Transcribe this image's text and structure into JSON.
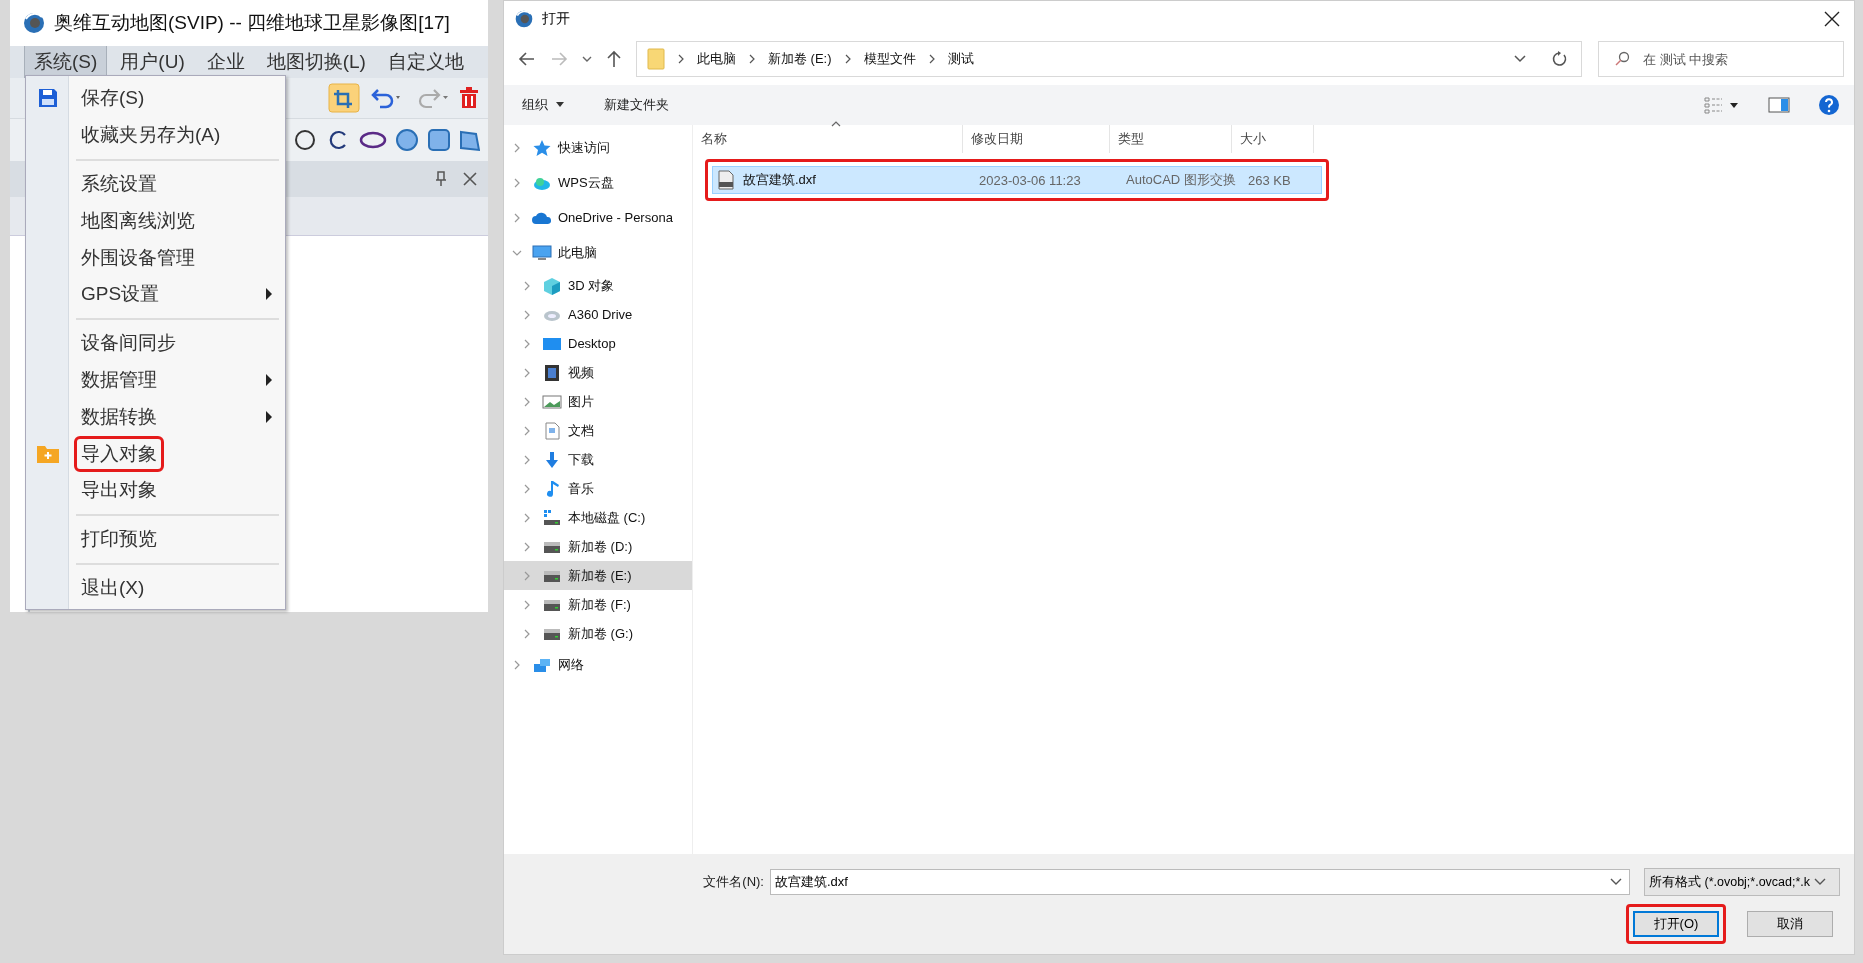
{
  "app": {
    "title": "奥维互动地图(SVIP) -- 四维地球卫星影像图[17]",
    "menu_bar": [
      {
        "label": "系统(S)",
        "selected": true
      },
      {
        "label": "用户(U)",
        "selected": false
      },
      {
        "label": "企业",
        "selected": false
      },
      {
        "label": "地图切换(L)",
        "selected": false
      },
      {
        "label": "自定义地",
        "selected": false
      }
    ],
    "menu": [
      {
        "kind": "save",
        "label": "保存(S)",
        "submenu": false,
        "highlighted": false
      },
      {
        "kind": "plain",
        "label": "收藏夹另存为(A)",
        "submenu": false,
        "highlighted": false
      },
      {
        "kind": "separator"
      },
      {
        "kind": "plain",
        "label": "系统设置",
        "submenu": false,
        "highlighted": false
      },
      {
        "kind": "plain",
        "label": "地图离线浏览",
        "submenu": false,
        "highlighted": false
      },
      {
        "kind": "plain",
        "label": "外围设备管理",
        "submenu": false,
        "highlighted": false
      },
      {
        "kind": "plain",
        "label": "GPS设置",
        "submenu": true,
        "highlighted": false
      },
      {
        "kind": "separator"
      },
      {
        "kind": "plain",
        "label": "设备间同步",
        "submenu": false,
        "highlighted": false
      },
      {
        "kind": "plain",
        "label": "数据管理",
        "submenu": true,
        "highlighted": false
      },
      {
        "kind": "plain",
        "label": "数据转换",
        "submenu": true,
        "highlighted": false
      },
      {
        "kind": "import",
        "label": "导入对象",
        "submenu": false,
        "highlighted": true
      },
      {
        "kind": "plain",
        "label": "导出对象",
        "submenu": false,
        "highlighted": false
      },
      {
        "kind": "separator"
      },
      {
        "kind": "plain",
        "label": "打印预览",
        "submenu": false,
        "highlighted": false
      },
      {
        "kind": "separator"
      },
      {
        "kind": "plain",
        "label": "退出(X)",
        "submenu": false,
        "highlighted": false
      }
    ]
  },
  "dialog": {
    "title": "打开",
    "breadcrumb": [
      "此电脑",
      "新加卷 (E:)",
      "模型文件",
      "测试"
    ],
    "search": {
      "placeholder": "在 测试 中搜索"
    },
    "toolbar": [
      {
        "label": "组织",
        "dropdown": true
      },
      {
        "label": "新建文件夹",
        "dropdown": false
      }
    ],
    "nav_tree": [
      {
        "label": "快速访问",
        "kind": "star",
        "expanded": false,
        "selected": false
      },
      {
        "label": "WPS云盘",
        "kind": "wps",
        "expanded": false,
        "selected": false
      },
      {
        "label": "OneDrive - Persona",
        "kind": "cloud",
        "expanded": false,
        "selected": false
      },
      {
        "label": "此电脑",
        "kind": "pc",
        "expanded": true,
        "selected": false,
        "children": [
          {
            "label": "3D 对象",
            "kind": "cube",
            "expanded": false,
            "selected": false
          },
          {
            "label": "A360 Drive",
            "kind": "a360",
            "expanded": false,
            "selected": false
          },
          {
            "label": "Desktop",
            "kind": "desktop",
            "expanded": false,
            "selected": false
          },
          {
            "label": "视频",
            "kind": "video",
            "expanded": false,
            "selected": false
          },
          {
            "label": "图片",
            "kind": "picture",
            "expanded": false,
            "selected": false
          },
          {
            "label": "文档",
            "kind": "document",
            "expanded": false,
            "selected": false
          },
          {
            "label": "下载",
            "kind": "download",
            "expanded": false,
            "selected": false
          },
          {
            "label": "音乐",
            "kind": "music",
            "expanded": false,
            "selected": false
          },
          {
            "label": "本地磁盘 (C:)",
            "kind": "sysdrive",
            "expanded": false,
            "selected": false
          },
          {
            "label": "新加卷 (D:)",
            "kind": "drive",
            "expanded": false,
            "selected": false
          },
          {
            "label": "新加卷 (E:)",
            "kind": "drive",
            "expanded": false,
            "selected": true
          },
          {
            "label": "新加卷 (F:)",
            "kind": "drive",
            "expanded": false,
            "selected": false
          },
          {
            "label": "新加卷 (G:)",
            "kind": "drive",
            "expanded": false,
            "selected": false
          }
        ]
      },
      {
        "label": "网络",
        "kind": "network",
        "expanded": false,
        "selected": false
      }
    ],
    "columns": [
      "名称",
      "修改日期",
      "类型",
      "大小"
    ],
    "files": [
      {
        "name": "故宫建筑.dxf",
        "modified": "2023-03-06 11:23",
        "type": "AutoCAD 图形交换",
        "size": "263 KB",
        "selected": true,
        "highlighted": true
      }
    ],
    "filename_label": "文件名(N):",
    "filename": "故宫建筑.dxf",
    "filter": "所有格式 (*.ovobj;*.ovcad;*.k",
    "buttons": [
      {
        "label": "打开(O)",
        "default": true,
        "highlighted": true
      },
      {
        "label": "取消",
        "default": false,
        "highlighted": false
      }
    ]
  }
}
